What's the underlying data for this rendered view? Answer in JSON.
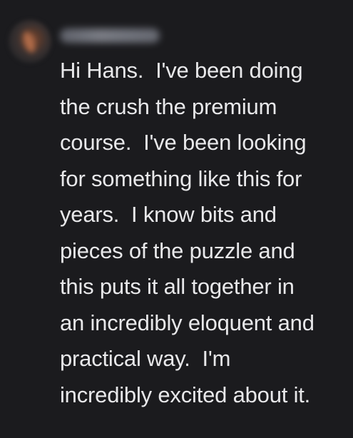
{
  "message": {
    "lines": [
      "Hi Hans.  I've been doing",
      "the crush the premium",
      "course.  I've been looking",
      "for something like this for",
      "years.  I know bits and",
      "pieces of the puzzle and",
      "this puts it all together in",
      "an incredibly eloquent and",
      "practical way.  I'm",
      "incredibly excited about it."
    ]
  }
}
